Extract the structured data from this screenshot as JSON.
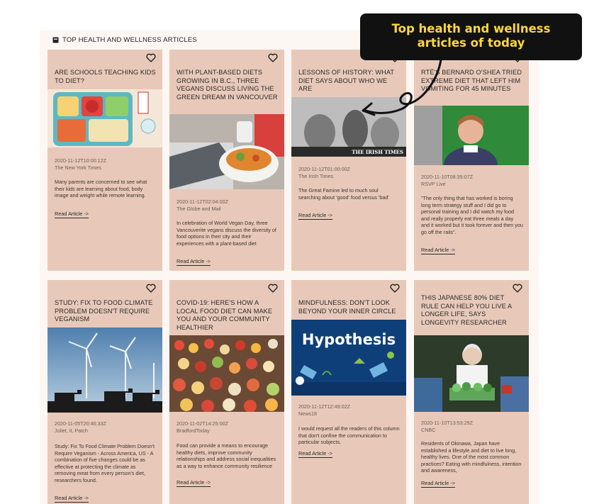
{
  "section": {
    "title": "TOP HEALTH AND WELLNESS ARTICLES"
  },
  "callout": {
    "line1": "Top health and wellness",
    "line2": "articles of today"
  },
  "cards": [
    {
      "title": "ARE SCHOOLS TEACHING KIDS TO DIET?",
      "date": "2020-11-12T10:00:12Z",
      "source": "The New York Times",
      "desc": "Many parents are concerned to see what their kids are learning about food, body image and weight while remote learning.",
      "read": "Read Article ->",
      "image": "school-lunch-tray"
    },
    {
      "title": "WITH PLANT-BASED DIETS GROWING IN B.C., THREE VEGANS DISCUSS LIVING THE GREEN DREAM IN VANCOUVER",
      "date": "2020-11-12T02:04:00Z",
      "source": "The Globe and Mail",
      "desc": "In celebration of World Vegan Day, three Vancouverite vegans discuss the diversity of food options in their city and their experiences with a plant-based diet",
      "read": "Read Article ->",
      "image": "salad-bowl-laptop"
    },
    {
      "title": "LESSONS OF HISTORY: WHAT DIET SAYS ABOUT WHO WE ARE",
      "date": "2020-11-12T01:00:00Z",
      "source": "The Irish Times",
      "desc": "The Great Famine led to much soul searching about 'good' food versus 'bad'",
      "read": "Read Article ->",
      "image": "historic-engraving",
      "image_caption": "THE IRISH TIMES"
    },
    {
      "title": "RTÉ'S BERNARD O'SHEA TRIED EXTREME DIET THAT LEFT HIM VOMITING FOR 45 MINUTES",
      "date": "2020-11-10T08:35:07Z",
      "source": "RSVP Live",
      "desc": "\"The only thing that has worked is boring long term strategy stuff and I did go to personal training and I did watch my food and really properly eat three meals a day and it worked but it took forever and then you go off the rails\".",
      "read": "Read Article ->",
      "image": "man-green-screen"
    },
    {
      "title": "STUDY: FIX TO FOOD CLIMATE PROBLEM DOESN'T REQUIRE VEGANISM",
      "date": "2020-11-05T20:46:33Z",
      "source": "Joliet, IL Patch",
      "desc": "Study: Fix To Food Climate Problem Doesn't Require Veganism - Across America, US - A combination of five changes could be as effective at protecting the climate as removing meat from every person's diet, researchers found.",
      "read": "Read Article ->",
      "image": "cows-wind-turbines"
    },
    {
      "title": "COVID-19: HERE'S HOW A LOCAL FOOD DIET CAN MAKE YOU AND YOUR COMMUNITY HEALTHIER",
      "date": "2020-11-02T14:25:00Z",
      "source": "BradfordToday",
      "desc": "Food can provide a means to encourage healthy diets, improve community relationships and address social inequalities as a way to enhance community resilience",
      "read": "Read Article ->",
      "image": "buffet-food"
    },
    {
      "title": "MINDFULNESS: DON'T LOOK BEYOND YOUR INNER CIRCLE",
      "date": "2020-11-12T12:49:02Z",
      "source": "News18",
      "desc": "I would request all the readers of this column that don't confine the communication to particular subjects,",
      "read": "Read Article ->",
      "image": "hypothesis-graphic",
      "image_caption": "Hypothesis"
    },
    {
      "title": "THIS JAPANESE 80% DIET RULE CAN HELP YOU LIVE A LONGER LIFE, SAYS LONGEVITY RESEARCHER",
      "date": "2020-11-10T13:53:29Z",
      "source": "CNBC",
      "desc": "Residents of Okinawa, Japan have established a lifestyle and diet to live long, healthy lives. One of the most common practices? Eating with mindfulness, intention and awareness,",
      "read": "Read Article ->",
      "image": "woman-vegetables"
    }
  ]
}
